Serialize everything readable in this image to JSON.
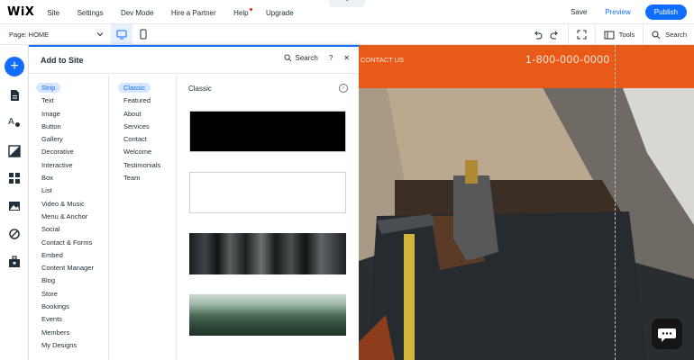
{
  "topbar": {
    "logo": "WiX",
    "menu": [
      "Site",
      "Settings",
      "Dev Mode",
      "Hire a Partner",
      "Help",
      "Upgrade"
    ],
    "collapse": "⌃",
    "save": "Save",
    "preview": "Preview",
    "publish": "Publish"
  },
  "toolbar": {
    "page": "Page: HOME",
    "tools": "Tools",
    "search": "Search"
  },
  "panel": {
    "title": "Add to Site",
    "search": "Search",
    "help": "?",
    "close": "✕",
    "categories": [
      "Strip",
      "Text",
      "Image",
      "Button",
      "Gallery",
      "Decorative",
      "Interactive",
      "Box",
      "List",
      "Video & Music",
      "Menu & Anchor",
      "Social",
      "Contact & Forms",
      "Embed",
      "Content Manager",
      "Blog",
      "Store",
      "Bookings",
      "Events",
      "Members",
      "My Designs"
    ],
    "subcategories": [
      "Classic",
      "Featured",
      "About",
      "Services",
      "Contact",
      "Welcome",
      "Testimonials",
      "Team"
    ],
    "section": "Classic",
    "info": "i"
  },
  "site": {
    "contact": "CONTACT US",
    "phone": "1-800-000-0000"
  },
  "colors": {
    "accent": "#116dff",
    "header": "#e85a18"
  }
}
